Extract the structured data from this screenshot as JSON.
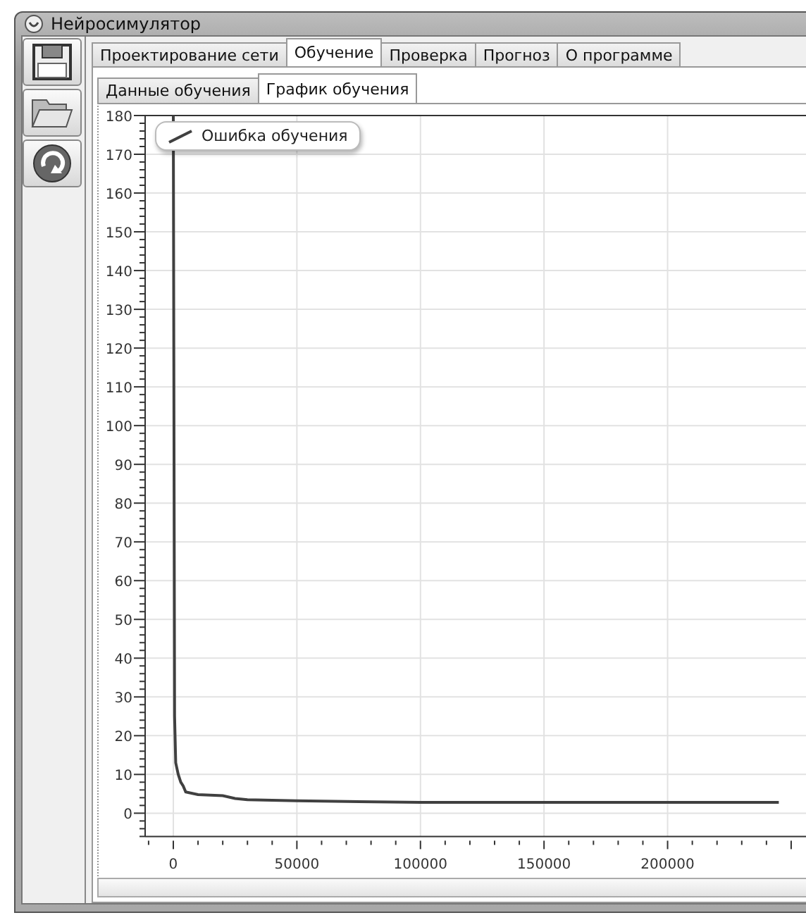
{
  "window": {
    "title": "Нейросимулятор"
  },
  "toolbar": [
    {
      "kind": "save"
    },
    {
      "kind": "open"
    },
    {
      "kind": "refresh"
    }
  ],
  "tabs": [
    {
      "label": "Проектирование сети",
      "selected": false
    },
    {
      "label": "Обучение",
      "selected": true
    },
    {
      "label": "Проверка",
      "selected": false
    },
    {
      "label": "Прогноз",
      "selected": false
    },
    {
      "label": "О программе",
      "selected": false
    }
  ],
  "subtabs": [
    {
      "label": "Данные обучения",
      "selected": false
    },
    {
      "label": "График обучения",
      "selected": true
    }
  ],
  "chart": {
    "chart_data": {
      "type": "line",
      "xlim": [
        -11400,
        256000
      ],
      "ylim": [
        -6,
        180
      ],
      "xticks": [
        0,
        50000,
        100000,
        150000,
        200000
      ],
      "grid": true,
      "yticks": [
        0,
        10,
        20,
        30,
        40,
        50,
        60,
        70,
        80,
        90,
        100,
        110,
        120,
        130,
        140,
        150,
        160,
        170,
        180
      ],
      "series": [
        {
          "name": "Ошибка обучения",
          "color": "#404040",
          "x": [
            0,
            500,
            1000,
            2000,
            3000,
            4000,
            5000,
            10000,
            20000,
            25000,
            30000,
            50000,
            100000,
            245000
          ],
          "values": [
            180,
            25,
            13,
            10,
            8,
            7,
            5.5,
            4.8,
            4.5,
            3.8,
            3.5,
            3.2,
            2.8,
            2.8
          ]
        }
      ]
    }
  }
}
